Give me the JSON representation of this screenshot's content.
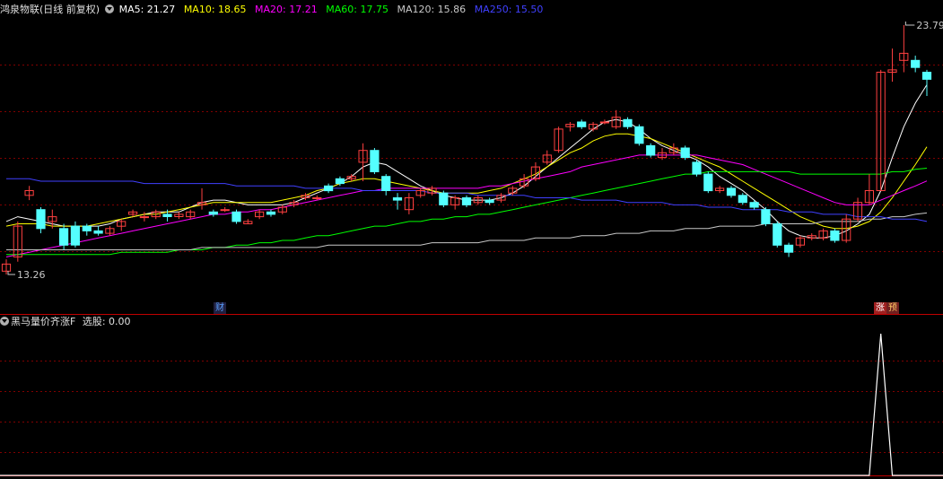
{
  "header": {
    "stock_label": "鸿泉物联(日线 前复权)",
    "indicators": [
      {
        "text": "MA5: 21.27",
        "color": "#ffffff"
      },
      {
        "text": "MA10: 18.65",
        "color": "#ffff00"
      },
      {
        "text": "MA20: 17.21",
        "color": "#ff00ff"
      },
      {
        "text": "MA60: 17.75",
        "color": "#00ff00"
      },
      {
        "text": "MA120: 15.86",
        "color": "#c8c8c8"
      },
      {
        "text": "MA250: 15.50",
        "color": "#4040ff"
      }
    ]
  },
  "sub_header": {
    "indicator_name": "黑马量价齐涨F",
    "value_text": "选股: 0.00"
  },
  "price_labels": {
    "high": "23.79",
    "low": "13.26"
  },
  "markers": [
    {
      "text": "财",
      "color": "#5aa0ff",
      "bg": "#202040"
    },
    {
      "text": "涨",
      "color": "#ffffff",
      "bg": "#a02020"
    },
    {
      "text": "预",
      "color": "#ffcc66",
      "bg": "#702020"
    }
  ],
  "colors": {
    "up": "#ff4040",
    "down": "#54ffff",
    "grid": "#800000",
    "border": "#c00000",
    "signal": "#ffffff"
  },
  "chart_data": {
    "type": "candlestick",
    "ylim": [
      13.26,
      23.79
    ],
    "candles": [
      [
        13.4,
        13.7,
        13.26,
        13.9
      ],
      [
        14.0,
        15.3,
        13.8,
        15.5
      ],
      [
        16.6,
        16.8,
        16.4,
        17.0
      ],
      [
        16.0,
        15.2,
        15.0,
        16.1
      ],
      [
        15.5,
        15.7,
        15.2,
        16.0
      ],
      [
        15.2,
        14.5,
        14.3,
        15.4
      ],
      [
        15.3,
        14.5,
        14.4,
        15.5
      ],
      [
        15.3,
        15.1,
        14.9,
        15.4
      ],
      [
        15.1,
        15.0,
        14.9,
        15.3
      ],
      [
        15.0,
        15.2,
        14.9,
        15.3
      ],
      [
        15.3,
        15.5,
        15.1,
        15.6
      ],
      [
        15.8,
        15.9,
        15.7,
        16.0
      ],
      [
        15.7,
        15.7,
        15.5,
        15.9
      ],
      [
        15.7,
        15.9,
        15.6,
        16.0
      ],
      [
        15.8,
        15.7,
        15.5,
        16.0
      ],
      [
        15.7,
        15.8,
        15.6,
        15.9
      ],
      [
        15.7,
        15.9,
        15.6,
        16.0
      ],
      [
        16.2,
        16.3,
        16.0,
        16.9
      ],
      [
        15.9,
        15.8,
        15.7,
        16.0
      ],
      [
        16.0,
        16.0,
        15.9,
        16.1
      ],
      [
        15.9,
        15.5,
        15.4,
        16.0
      ],
      [
        15.4,
        15.5,
        15.4,
        15.6
      ],
      [
        15.7,
        15.9,
        15.6,
        16.0
      ],
      [
        15.9,
        15.8,
        15.7,
        16.0
      ],
      [
        15.9,
        16.1,
        15.8,
        16.2
      ],
      [
        16.2,
        16.3,
        16.1,
        16.4
      ],
      [
        16.5,
        16.6,
        16.4,
        16.7
      ],
      [
        16.5,
        16.5,
        16.4,
        16.6
      ],
      [
        17.0,
        16.8,
        16.7,
        17.1
      ],
      [
        17.3,
        17.1,
        17.0,
        17.4
      ],
      [
        17.3,
        17.4,
        17.2,
        17.5
      ],
      [
        18.0,
        18.5,
        17.2,
        18.8
      ],
      [
        18.5,
        17.6,
        17.5,
        18.6
      ],
      [
        17.4,
        16.8,
        16.6,
        17.5
      ],
      [
        16.5,
        16.4,
        16.0,
        16.7
      ],
      [
        16.0,
        16.5,
        15.8,
        16.7
      ],
      [
        16.6,
        16.8,
        16.5,
        16.9
      ],
      [
        16.7,
        16.9,
        16.6,
        17.0
      ],
      [
        16.7,
        16.2,
        16.1,
        16.8
      ],
      [
        16.2,
        16.5,
        16.0,
        16.6
      ],
      [
        16.5,
        16.2,
        16.1,
        16.6
      ],
      [
        16.3,
        16.5,
        16.2,
        16.6
      ],
      [
        16.4,
        16.3,
        16.2,
        16.5
      ],
      [
        16.4,
        16.6,
        16.3,
        16.7
      ],
      [
        16.7,
        16.9,
        16.6,
        17.0
      ],
      [
        17.0,
        17.3,
        16.9,
        17.5
      ],
      [
        17.3,
        17.8,
        17.2,
        18.0
      ],
      [
        18.0,
        18.3,
        17.9,
        18.5
      ],
      [
        18.5,
        19.4,
        18.4,
        19.5
      ],
      [
        19.5,
        19.6,
        19.3,
        19.7
      ],
      [
        19.7,
        19.5,
        19.4,
        19.8
      ],
      [
        19.4,
        19.6,
        19.3,
        19.7
      ],
      [
        19.7,
        19.7,
        19.6,
        19.8
      ],
      [
        19.5,
        19.9,
        19.4,
        20.2
      ],
      [
        19.8,
        19.5,
        19.4,
        19.9
      ],
      [
        19.5,
        18.8,
        18.7,
        19.6
      ],
      [
        18.7,
        18.3,
        18.2,
        18.8
      ],
      [
        18.2,
        18.4,
        18.1,
        18.6
      ],
      [
        18.4,
        18.6,
        18.3,
        18.8
      ],
      [
        18.6,
        18.2,
        18.1,
        18.7
      ],
      [
        18.0,
        17.5,
        17.4,
        18.1
      ],
      [
        17.5,
        16.8,
        16.7,
        17.6
      ],
      [
        16.8,
        16.9,
        16.7,
        17.0
      ],
      [
        16.9,
        16.6,
        16.5,
        17.0
      ],
      [
        16.6,
        16.3,
        16.2,
        16.7
      ],
      [
        16.3,
        16.1,
        16.0,
        16.4
      ],
      [
        16.0,
        15.4,
        15.3,
        16.1
      ],
      [
        15.4,
        14.5,
        14.4,
        15.5
      ],
      [
        14.5,
        14.2,
        14.0,
        14.6
      ],
      [
        14.5,
        14.8,
        14.4,
        14.9
      ],
      [
        14.8,
        14.9,
        14.7,
        15.0
      ],
      [
        14.8,
        15.1,
        14.7,
        15.2
      ],
      [
        15.1,
        14.7,
        14.6,
        15.2
      ],
      [
        14.7,
        15.6,
        14.6,
        15.8
      ],
      [
        15.6,
        16.3,
        15.5,
        16.5
      ],
      [
        16.3,
        16.8,
        16.2,
        17.5
      ],
      [
        16.8,
        21.8,
        16.8,
        21.9
      ],
      [
        21.8,
        21.9,
        21.4,
        22.8
      ],
      [
        22.3,
        22.6,
        21.8,
        23.79
      ],
      [
        22.3,
        22.0,
        21.8,
        22.5
      ],
      [
        21.8,
        21.5,
        20.8,
        21.9
      ]
    ],
    "ma_series": [
      {
        "name": "MA5",
        "values": [
          15.5,
          15.7,
          15.6,
          15.5,
          15.4,
          15.3,
          15.3,
          15.3,
          15.3,
          15.4,
          15.6,
          15.7,
          15.8,
          15.9,
          15.9,
          15.9,
          16.1,
          16.3,
          16.4,
          16.4,
          16.3,
          16.2,
          16.2,
          16.2,
          16.2,
          16.3,
          16.5,
          16.7,
          16.9,
          17.1,
          17.4,
          17.8,
          18.0,
          17.9,
          17.6,
          17.3,
          17.0,
          16.8,
          16.6,
          16.5,
          16.4,
          16.4,
          16.4,
          16.5,
          16.7,
          17.0,
          17.4,
          17.8,
          18.2,
          18.6,
          19.0,
          19.4,
          19.7,
          19.8,
          19.7,
          19.4,
          19.0,
          18.7,
          18.5,
          18.3,
          18.1,
          17.8,
          17.4,
          17.1,
          16.8,
          16.4,
          16.0,
          15.5,
          15.1,
          14.9,
          14.8,
          14.8,
          14.9,
          15.1,
          15.4,
          15.8,
          16.8,
          18.2,
          19.5,
          20.5,
          21.27
        ]
      },
      {
        "name": "MA10",
        "values": [
          15.3,
          15.4,
          15.4,
          15.4,
          15.3,
          15.3,
          15.3,
          15.3,
          15.4,
          15.5,
          15.6,
          15.7,
          15.8,
          15.8,
          15.9,
          16.0,
          16.1,
          16.2,
          16.3,
          16.3,
          16.3,
          16.3,
          16.3,
          16.3,
          16.4,
          16.5,
          16.6,
          16.8,
          16.9,
          17.1,
          17.2,
          17.3,
          17.3,
          17.2,
          17.1,
          17.0,
          16.9,
          16.8,
          16.7,
          16.7,
          16.7,
          16.7,
          16.8,
          16.9,
          17.1,
          17.3,
          17.5,
          17.8,
          18.1,
          18.4,
          18.6,
          18.9,
          19.1,
          19.2,
          19.2,
          19.1,
          19.0,
          18.8,
          18.6,
          18.4,
          18.2,
          18.0,
          17.8,
          17.5,
          17.2,
          16.9,
          16.6,
          16.3,
          16.0,
          15.7,
          15.5,
          15.3,
          15.2,
          15.2,
          15.3,
          15.5,
          15.9,
          16.5,
          17.2,
          17.9,
          18.65
        ]
      },
      {
        "name": "MA20",
        "values": [
          14.0,
          14.1,
          14.2,
          14.3,
          14.4,
          14.5,
          14.6,
          14.7,
          14.8,
          14.9,
          15.0,
          15.1,
          15.2,
          15.3,
          15.4,
          15.5,
          15.6,
          15.7,
          15.8,
          15.8,
          15.9,
          15.9,
          16.0,
          16.0,
          16.1,
          16.2,
          16.3,
          16.4,
          16.5,
          16.6,
          16.7,
          16.8,
          16.8,
          16.9,
          16.9,
          16.9,
          16.9,
          16.9,
          16.9,
          16.9,
          16.9,
          16.9,
          17.0,
          17.0,
          17.1,
          17.2,
          17.3,
          17.4,
          17.5,
          17.6,
          17.8,
          17.9,
          18.0,
          18.1,
          18.2,
          18.3,
          18.3,
          18.3,
          18.3,
          18.3,
          18.3,
          18.2,
          18.1,
          18.0,
          17.9,
          17.7,
          17.5,
          17.3,
          17.1,
          16.9,
          16.7,
          16.5,
          16.3,
          16.2,
          16.2,
          16.2,
          16.4,
          16.6,
          16.8,
          17.0,
          17.21
        ]
      },
      {
        "name": "MA60",
        "values": [
          14.1,
          14.1,
          14.1,
          14.1,
          14.1,
          14.1,
          14.1,
          14.1,
          14.1,
          14.1,
          14.2,
          14.2,
          14.2,
          14.2,
          14.2,
          14.3,
          14.3,
          14.3,
          14.4,
          14.4,
          14.5,
          14.5,
          14.6,
          14.6,
          14.7,
          14.7,
          14.8,
          14.9,
          14.9,
          15.0,
          15.1,
          15.2,
          15.3,
          15.3,
          15.4,
          15.5,
          15.5,
          15.6,
          15.6,
          15.7,
          15.7,
          15.8,
          15.8,
          15.9,
          16.0,
          16.1,
          16.2,
          16.3,
          16.4,
          16.5,
          16.6,
          16.7,
          16.8,
          16.9,
          17.0,
          17.1,
          17.2,
          17.3,
          17.4,
          17.5,
          17.5,
          17.6,
          17.6,
          17.6,
          17.6,
          17.6,
          17.6,
          17.6,
          17.6,
          17.5,
          17.5,
          17.5,
          17.5,
          17.5,
          17.5,
          17.5,
          17.5,
          17.6,
          17.6,
          17.7,
          17.75
        ]
      },
      {
        "name": "MA120",
        "values": [
          14.3,
          14.3,
          14.3,
          14.3,
          14.3,
          14.3,
          14.3,
          14.3,
          14.3,
          14.3,
          14.3,
          14.3,
          14.3,
          14.3,
          14.3,
          14.3,
          14.3,
          14.4,
          14.4,
          14.4,
          14.4,
          14.4,
          14.4,
          14.4,
          14.4,
          14.4,
          14.4,
          14.4,
          14.5,
          14.5,
          14.5,
          14.5,
          14.5,
          14.5,
          14.5,
          14.5,
          14.5,
          14.6,
          14.6,
          14.6,
          14.6,
          14.6,
          14.7,
          14.7,
          14.7,
          14.7,
          14.8,
          14.8,
          14.8,
          14.8,
          14.9,
          14.9,
          14.9,
          15.0,
          15.0,
          15.0,
          15.1,
          15.1,
          15.1,
          15.2,
          15.2,
          15.2,
          15.3,
          15.3,
          15.3,
          15.3,
          15.4,
          15.4,
          15.4,
          15.4,
          15.4,
          15.5,
          15.5,
          15.5,
          15.5,
          15.6,
          15.6,
          15.7,
          15.7,
          15.8,
          15.86
        ]
      },
      {
        "name": "MA250",
        "values": [
          17.3,
          17.3,
          17.3,
          17.2,
          17.2,
          17.2,
          17.2,
          17.2,
          17.2,
          17.2,
          17.2,
          17.2,
          17.1,
          17.1,
          17.1,
          17.1,
          17.1,
          17.1,
          17.1,
          17.1,
          17.0,
          17.0,
          17.0,
          17.0,
          17.0,
          17.0,
          16.9,
          16.9,
          16.9,
          16.9,
          16.9,
          16.8,
          16.8,
          16.8,
          16.8,
          16.8,
          16.8,
          16.7,
          16.7,
          16.7,
          16.7,
          16.6,
          16.6,
          16.6,
          16.6,
          16.6,
          16.5,
          16.5,
          16.5,
          16.5,
          16.4,
          16.4,
          16.4,
          16.4,
          16.3,
          16.3,
          16.3,
          16.3,
          16.2,
          16.2,
          16.2,
          16.1,
          16.1,
          16.1,
          16.0,
          16.0,
          16.0,
          16.0,
          15.9,
          15.9,
          15.9,
          15.8,
          15.8,
          15.8,
          15.7,
          15.7,
          15.7,
          15.6,
          15.6,
          15.6,
          15.5
        ]
      }
    ],
    "signal": {
      "peak_index": 76,
      "ylim": [
        0,
        1
      ],
      "values_note": ""
    }
  }
}
